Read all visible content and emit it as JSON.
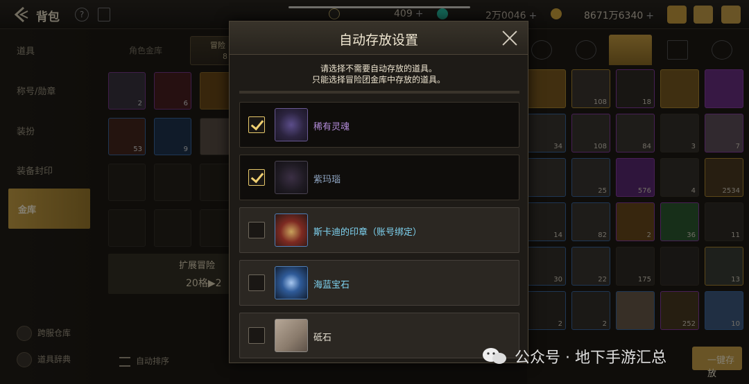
{
  "topbar": {
    "title": "背包",
    "help_label": "?",
    "currency_moon": "409",
    "currency_gold": "2万0046",
    "currency_coin": "8671万6340",
    "plus": "+"
  },
  "sidebar": {
    "items": [
      {
        "label": "道具"
      },
      {
        "label": "称号/勋章"
      },
      {
        "label": "装扮"
      },
      {
        "label": "装备封印"
      },
      {
        "label": "金库"
      }
    ],
    "active_index": 4,
    "bottom": [
      {
        "label": "跨服仓库"
      },
      {
        "label": "道具辞典"
      }
    ]
  },
  "vault": {
    "tab_character": "角色金库",
    "tab_adventure": "冒险",
    "tab_adventure_sub": "8",
    "slot_counts": [
      "2",
      "6",
      "",
      "53",
      "9",
      ""
    ],
    "expand_line1": "扩展冒险",
    "expand_line2": "20格▶2",
    "autosort_label": "自动排序"
  },
  "inventory": {
    "counts": [
      "",
      "108",
      "18",
      "",
      "",
      "34",
      "108",
      "84",
      "3",
      "7",
      "",
      "25",
      "576",
      "4",
      "2534",
      "14",
      "82",
      "2",
      "36",
      "11",
      "30",
      "22",
      "175",
      "",
      "13",
      "2",
      "2",
      "",
      "252",
      "10"
    ],
    "save_label": "一键存放"
  },
  "modal": {
    "title": "自动存放设置",
    "desc_line1": "请选择不需要自动存放的道具。",
    "desc_line2": "只能选择冒险团金库中存放的道具。",
    "items": [
      {
        "name": "稀有灵魂",
        "checked": true
      },
      {
        "name": "紫玛瑙",
        "checked": true
      },
      {
        "name": "斯卡迪的印章（账号绑定）",
        "checked": false
      },
      {
        "name": "海蓝宝石",
        "checked": false
      },
      {
        "name": "砥石",
        "checked": false
      }
    ]
  },
  "watermark": {
    "text": "公众号 · 地下手游汇总"
  },
  "colors": {
    "accent_gold": "#c9a24a",
    "rare_purple": "#b28bd8",
    "cyan_name": "#7fd4f2"
  }
}
